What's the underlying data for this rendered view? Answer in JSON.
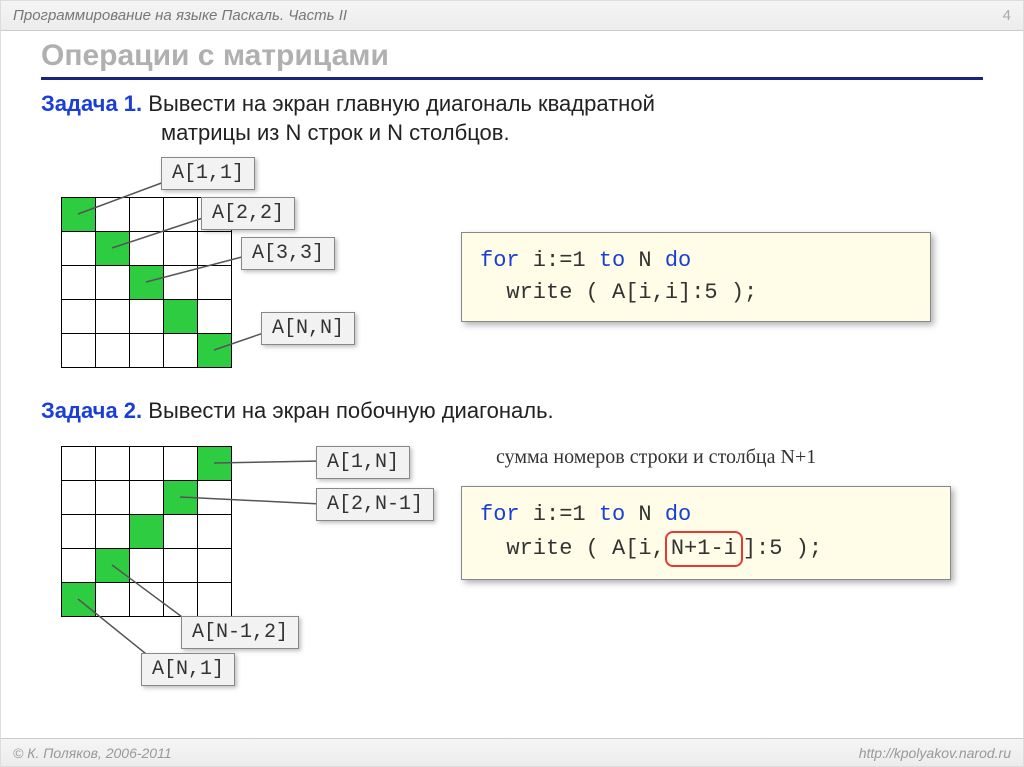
{
  "header": {
    "subtitle": "Программирование на языке Паскаль. Часть II",
    "page": "4"
  },
  "title": "Операции с матрицами",
  "task1": {
    "label": "Задача 1.",
    "text_line1": "Вывести на экран главную диагональ квадратной",
    "text_line2": "матрицы из N строк и N столбцов.",
    "callouts": [
      "A[1,1]",
      "A[2,2]",
      "A[3,3]",
      "A[N,N]"
    ],
    "code": {
      "kw1": "for",
      "part1": " i:=1 ",
      "kw2": "to",
      "part2": " N ",
      "kw3": "do",
      "line2": "  write ( A[i,i]:5 );"
    }
  },
  "task2": {
    "label": "Задача 2.",
    "text_line1": "Вывести на экран побочную диагональ.",
    "callouts": [
      "A[1,N]",
      "A[2,N-1]",
      "A[N-1,2]",
      "A[N,1]"
    ],
    "note": "сумма номеров строки и столбца N+1",
    "code": {
      "kw1": "for",
      "part1": " i:=1 ",
      "kw2": "to",
      "part2": " N ",
      "kw3": "do",
      "line2a": "  write ( A[i,",
      "highlight": "N+1-i",
      "line2b": "]:5 );"
    }
  },
  "footer": {
    "author": "© К. Поляков, 2006-2011",
    "url": "http://kpolyakov.narod.ru"
  }
}
